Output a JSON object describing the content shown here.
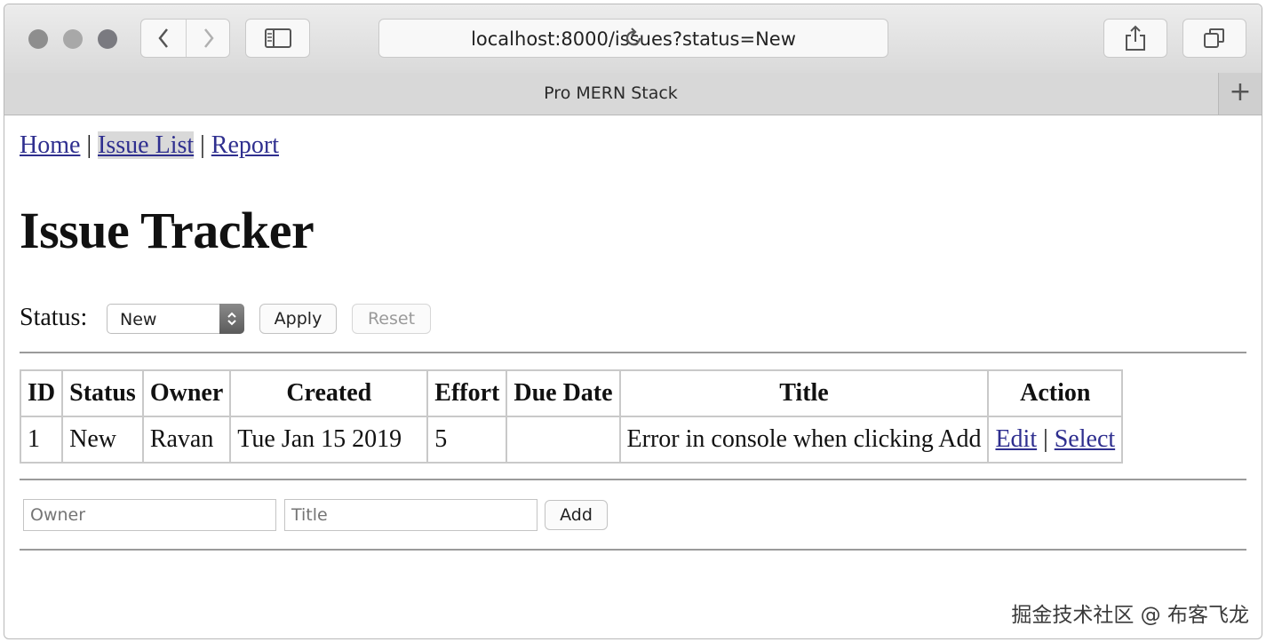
{
  "browser": {
    "url": "localhost:8000/issues?status=New",
    "tab_title": "Pro MERN Stack",
    "new_tab_label": "+"
  },
  "nav": {
    "home": "Home",
    "issue_list": "Issue List",
    "report": "Report",
    "separator": "|"
  },
  "page": {
    "title": "Issue Tracker"
  },
  "filter": {
    "label": "Status:",
    "selected": "New",
    "apply_label": "Apply",
    "reset_label": "Reset"
  },
  "table": {
    "headers": [
      "ID",
      "Status",
      "Owner",
      "Created",
      "Effort",
      "Due Date",
      "Title",
      "Action"
    ],
    "rows": [
      {
        "id": "1",
        "status": "New",
        "owner": "Ravan",
        "created": "Tue Jan 15 2019",
        "effort": "5",
        "due": "",
        "title": "Error in console when clicking Add",
        "edit_label": "Edit",
        "action_sep": "|",
        "select_label": "Select"
      }
    ]
  },
  "add_form": {
    "owner_placeholder": "Owner",
    "title_placeholder": "Title",
    "add_label": "Add"
  },
  "watermark": "掘金技术社区 @ 布客飞龙",
  "colors": {
    "link": "#2f2f8f",
    "active_link_bg": "#d9d9d9",
    "toolbar": "#e4e4e4"
  }
}
